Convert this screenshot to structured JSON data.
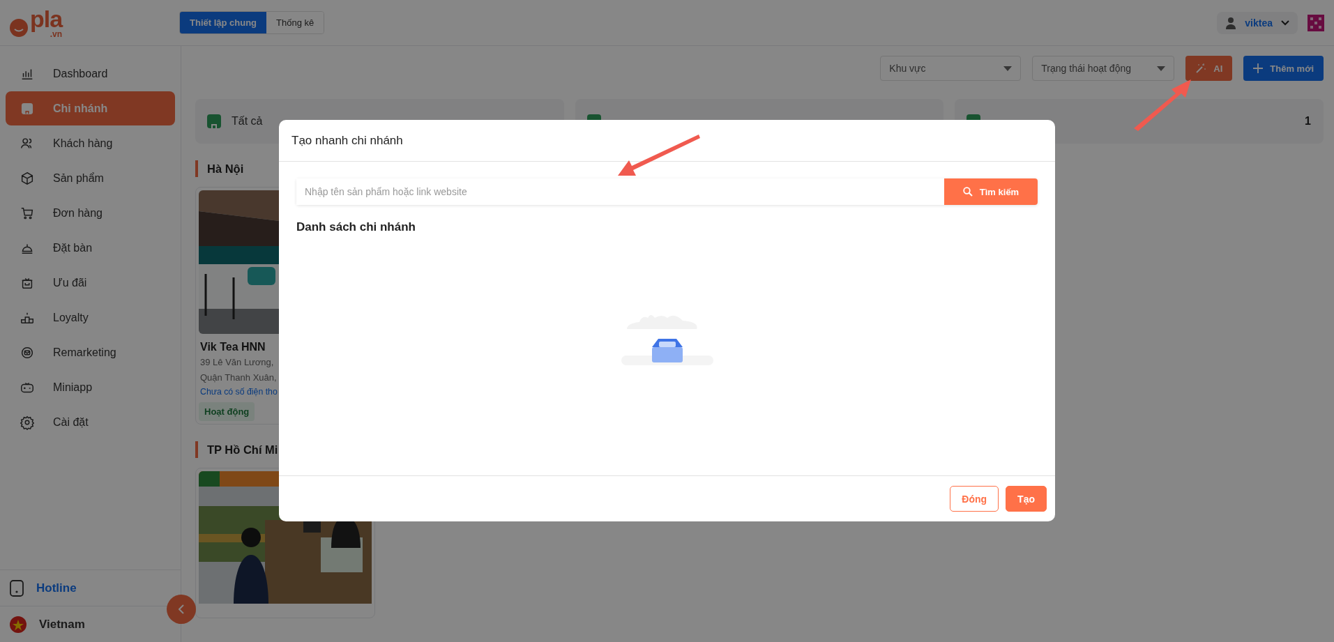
{
  "header": {
    "logo": {
      "name": "pla",
      "domain": ".vn"
    },
    "tabs": [
      {
        "label": "Thiết lập chung",
        "selected": true
      },
      {
        "label": "Thống kê",
        "selected": false
      }
    ],
    "user": {
      "name": "viktea"
    }
  },
  "sidebar": {
    "items": [
      {
        "label": "Dashboard",
        "selected": false
      },
      {
        "label": "Chi nhánh",
        "selected": true
      },
      {
        "label": "Khách hàng",
        "selected": false
      },
      {
        "label": "Sản phẩm",
        "selected": false
      },
      {
        "label": "Đơn hàng",
        "selected": false
      },
      {
        "label": "Đặt bàn",
        "selected": false
      },
      {
        "label": "Ưu đãi",
        "selected": false
      },
      {
        "label": "Loyalty",
        "selected": false
      },
      {
        "label": "Remarketing",
        "selected": false
      },
      {
        "label": "Miniapp",
        "selected": false
      },
      {
        "label": "Cài đặt",
        "selected": false
      }
    ],
    "hotline": "Hotline",
    "language": "Vietnam"
  },
  "toolbar": {
    "filters": [
      {
        "placeholder": "Khu vực"
      },
      {
        "placeholder": "Trạng thái hoạt động"
      }
    ],
    "ai_button": "AI",
    "add_button": "Thêm mới"
  },
  "stats": {
    "first_label": "Tất cả",
    "last_count": "1"
  },
  "sections": [
    {
      "title": "Hà Nội",
      "branches": [
        {
          "kind": "picture",
          "name": "Vik Tea HNN",
          "address": [
            "39 Lê Văn Lương,",
            "Quận Thanh Xuân,"
          ],
          "phone": "Chưa có số điện tho",
          "status": "Hoạt động"
        }
      ]
    },
    {
      "title": "TP Hồ Chí Mi"
    }
  ],
  "modal": {
    "title": "Tạo nhanh chi nhánh",
    "search_placeholder": "Nhập tên sản phẩm hoặc link website",
    "search_button": "Tìm kiếm",
    "list_title": "Danh sách chi nhánh",
    "buttons": [
      {
        "label": "Đóng",
        "kind": "outline"
      },
      {
        "label": "Tạo",
        "kind": "primary"
      }
    ]
  }
}
